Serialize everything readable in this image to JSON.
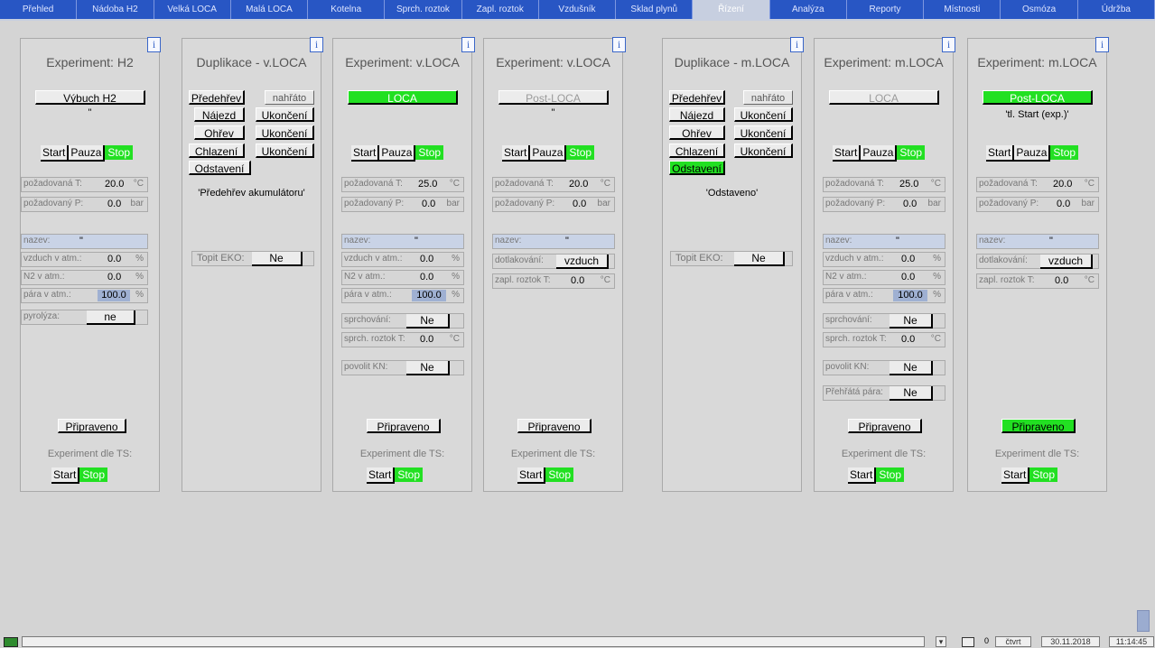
{
  "nav": {
    "tabs": [
      "Přehled",
      "Nádoba H2",
      "Velká LOCA",
      "Malá LOCA",
      "Kotelna",
      "Sprch. roztok",
      "Zapl. roztok",
      "Vzdušník",
      "Sklad plynů",
      "Řízení",
      "Analýza",
      "Reporty",
      "Místnosti",
      "Osmóza",
      "Údržba"
    ],
    "active_tab": "Řízení"
  },
  "info_label": "i",
  "panels": [
    {
      "title": "Experiment: H2",
      "main_button": "Výbuch H2",
      "sub_text": "\"",
      "start": "Start",
      "pause": "Pauza",
      "stop": "Stop",
      "fields": {
        "req_t_label": "požadovaná T:",
        "req_t": "20.0",
        "t_unit": "°C",
        "req_p_label": "požadovaný P:",
        "req_p": "0.0",
        "p_unit": "bar",
        "name_label": "nazev:",
        "name_val": "\"",
        "air_label": "vzduch v atm.:",
        "air": "0.0",
        "n2_label": "N2 v atm.:",
        "n2": "0.0",
        "steam_label": "pára v atm.:",
        "steam": "100.0",
        "pct": "%",
        "pyro_label": "pyrolýza:",
        "pyro": "ne"
      },
      "ready": "Připraveno",
      "ts_label": "Experiment dle TS:",
      "ts_start": "Start",
      "ts_stop": "Stop"
    },
    {
      "title": "Duplikace - v.LOCA",
      "rows": [
        {
          "left": "Předehřev",
          "right": "nahřáto"
        },
        {
          "left": "Nájezd",
          "right": "Ukončení"
        },
        {
          "left": "Ohřev",
          "right": "Ukončení"
        },
        {
          "left": "Chlazení",
          "right": "Ukončení"
        },
        {
          "left": "Odstavení",
          "right": ""
        }
      ],
      "status": "'Předehřev akumulátoru'",
      "eko_label": "Topit EKO:",
      "eko": "Ne"
    },
    {
      "title": "Experiment: v.LOCA",
      "main_button": "LOCA",
      "start": "Start",
      "pause": "Pauza",
      "stop": "Stop",
      "fields": {
        "req_t_label": "požadovaná T:",
        "req_t": "25.0",
        "t_unit": "°C",
        "req_p_label": "požadovaný P:",
        "req_p": "0.0",
        "p_unit": "bar",
        "name_label": "nazev:",
        "name_val": "\"",
        "air_label": "vzduch v atm.:",
        "air": "0.0",
        "n2_label": "N2 v atm.:",
        "n2": "0.0",
        "steam_label": "pára v atm.:",
        "steam": "100.0",
        "pct": "%",
        "spray_label": "sprchování:",
        "spray": "Ne",
        "spray_t_label": "sprch. roztok T:",
        "spray_t": "0.0",
        "kn_label": "povolit KN:",
        "kn": "Ne"
      },
      "ready": "Připraveno",
      "ts_label": "Experiment dle TS:",
      "ts_start": "Start",
      "ts_stop": "Stop"
    },
    {
      "title": "Experiment: v.LOCA",
      "main_button": "Post-LOCA",
      "sub_text": "\"",
      "start": "Start",
      "pause": "Pauza",
      "stop": "Stop",
      "fields": {
        "req_t_label": "požadovaná T:",
        "req_t": "20.0",
        "t_unit": "°C",
        "req_p_label": "požadovaný P:",
        "req_p": "0.0",
        "p_unit": "bar",
        "name_label": "nazev:",
        "name_val": "\"",
        "press_label": "dotlakování:",
        "press": "vzduch",
        "sol_t_label": "zapl. roztok T:",
        "sol_t": "0.0"
      },
      "ready": "Připraveno",
      "ts_label": "Experiment dle TS:",
      "ts_start": "Start",
      "ts_stop": "Stop"
    },
    {
      "title": "Duplikace - m.LOCA",
      "rows": [
        {
          "left": "Předehřev",
          "right": "nahřáto"
        },
        {
          "left": "Nájezd",
          "right": "Ukončení"
        },
        {
          "left": "Ohřev",
          "right": "Ukončení"
        },
        {
          "left": "Chlazení",
          "right": "Ukončení"
        },
        {
          "left": "Odstavení",
          "right": ""
        }
      ],
      "status": "'Odstaveno'",
      "eko_label": "Topit EKO:",
      "eko": "Ne"
    },
    {
      "title": "Experiment: m.LOCA",
      "main_button": "LOCA",
      "start": "Start",
      "pause": "Pauza",
      "stop": "Stop",
      "fields": {
        "req_t_label": "požadovaná T:",
        "req_t": "25.0",
        "t_unit": "°C",
        "req_p_label": "požadovaný P:",
        "req_p": "0.0",
        "p_unit": "bar",
        "name_label": "nazev:",
        "name_val": "\"",
        "air_label": "vzduch v atm.:",
        "air": "0.0",
        "n2_label": "N2 v atm.:",
        "n2": "0.0",
        "steam_label": "pára v atm.:",
        "steam": "100.0",
        "pct": "%",
        "spray_label": "sprchování:",
        "spray": "Ne",
        "spray_t_label": "sprch. roztok T:",
        "spray_t": "0.0",
        "kn_label": "povolit KN:",
        "kn": "Ne",
        "superheat_label": "Přehřátá pára:",
        "superheat": "Ne"
      },
      "ready": "Připraveno",
      "ts_label": "Experiment dle TS:",
      "ts_start": "Start",
      "ts_stop": "Stop"
    },
    {
      "title": "Experiment: m.LOCA",
      "main_button": "Post-LOCA",
      "sub_text": "'tl. Start (exp.)'",
      "start": "Start",
      "pause": "Pauza",
      "stop": "Stop",
      "fields": {
        "req_t_label": "požadovaná T:",
        "req_t": "20.0",
        "t_unit": "°C",
        "req_p_label": "požadovaný P:",
        "req_p": "0.0",
        "p_unit": "bar",
        "name_label": "nazev:",
        "name_val": "\"",
        "press_label": "dotlakování:",
        "press": "vzduch",
        "sol_t_label": "zapl. roztok T:",
        "sol_t": "0.0"
      },
      "ready": "Připraveno",
      "ts_label": "Experiment dle TS:",
      "ts_start": "Start",
      "ts_stop": "Stop"
    }
  ],
  "statusbar": {
    "count": "0",
    "day": "čtvrt",
    "date": "30.11.2018",
    "time": "11:14:45"
  },
  "colors": {
    "nav": "#2856c4",
    "active_green": "#22e022",
    "background": "#d4d4d4"
  }
}
